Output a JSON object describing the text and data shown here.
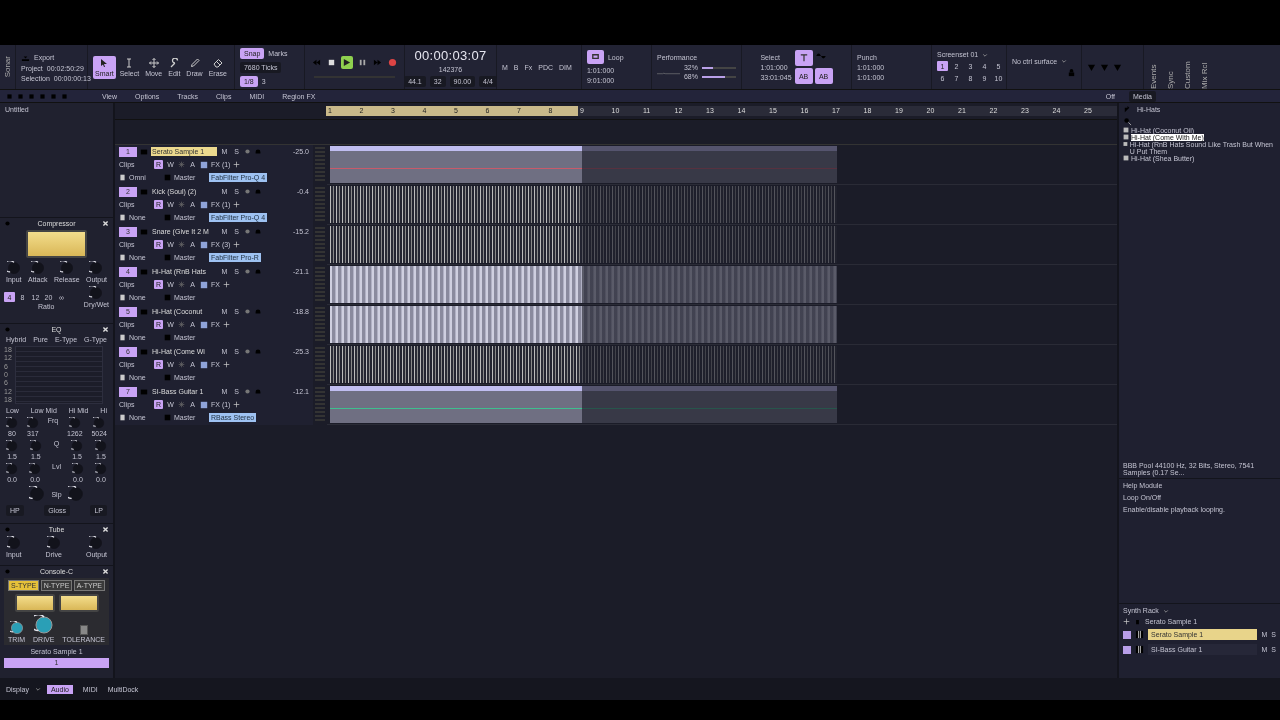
{
  "control_bar": {
    "app_name": "Sonar",
    "export": "Export",
    "project": {
      "label": "Project",
      "value": "00:02:50:29"
    },
    "selection": {
      "label": "Selection",
      "value": "00:00:00:13"
    },
    "tools": [
      {
        "label": "Smart",
        "selected": true
      },
      {
        "label": "Select",
        "selected": false
      },
      {
        "label": "Move",
        "selected": false
      },
      {
        "label": "Edit",
        "selected": false
      },
      {
        "label": "Draw",
        "selected": false
      },
      {
        "label": "Erase",
        "selected": false
      }
    ],
    "snap": {
      "label": "Snap",
      "on": true,
      "marks": "Marks",
      "resolution": "7680 Ticks",
      "value": "1/8",
      "number": "3"
    },
    "transport": {
      "playing": true
    },
    "time": "00:00:03:07",
    "ticks": "142376",
    "sample_rate": "44.1",
    "bit_depth": "32",
    "tempo": "90.00",
    "meter": "4/4",
    "mix_buttons": [
      "M",
      "B",
      "Fx",
      "PDC",
      "DIM"
    ],
    "loop": {
      "label": "Loop",
      "on": true,
      "start": "1:01:000",
      "end": "9:01:000"
    },
    "performance": {
      "label": "Performance",
      "cpu": {
        "reading": "32%",
        "level": 0.32
      },
      "disk": {
        "reading": "68%",
        "level": 0.68
      }
    },
    "select": {
      "label": "Select",
      "start": "1:01:000",
      "end": "33:01:045",
      "ab_labels": [
        "AB",
        "AB"
      ]
    },
    "punch": {
      "label": "Punch",
      "start": "1:01:000",
      "end": "1:01:000"
    },
    "screenset": {
      "label": "Screenset 01",
      "slots": [
        {
          "label": "1",
          "selected": true
        },
        {
          "label": "2",
          "selected": false
        },
        {
          "label": "3",
          "selected": false
        },
        {
          "label": "4",
          "selected": false
        },
        {
          "label": "5",
          "selected": false
        },
        {
          "label": "6",
          "selected": false
        },
        {
          "label": "7",
          "selected": false
        },
        {
          "label": "8",
          "selected": false
        },
        {
          "label": "9",
          "selected": false
        },
        {
          "label": "10",
          "selected": false
        }
      ]
    },
    "control_surface": "No ctrl surface",
    "side_tabs": [
      "Events",
      "Sync",
      "Custom",
      "Mix Rcl"
    ]
  },
  "toolbar": {
    "menus": [
      "View",
      "Options",
      "Tracks",
      "Clips",
      "MIDI",
      "Region FX"
    ],
    "region_fx": "Off",
    "browser_tab": "Media"
  },
  "inspector": {
    "title": "Untitled",
    "compressor": {
      "title": "Compressor",
      "knobs": [
        "Input",
        "Attack",
        "Release",
        "Output"
      ],
      "ratios": [
        {
          "label": "4",
          "selected": true
        },
        {
          "label": "8",
          "selected": false
        },
        {
          "label": "12",
          "selected": false
        },
        {
          "label": "20",
          "selected": false
        },
        {
          "label": "∞",
          "selected": false
        }
      ],
      "ratio_label": "Ratio",
      "mix_label": "Dry/Wet"
    },
    "eq": {
      "title": "EQ",
      "types": [
        "Hybrid",
        "Pure",
        "E-Type",
        "G-Type"
      ],
      "scale": [
        "18",
        "12",
        "6",
        "0",
        "6",
        "12",
        "18"
      ],
      "bands": [
        "Low",
        "Low Mid",
        "Hi Mid",
        "Hi"
      ],
      "freq": [
        "80",
        "317",
        "1262",
        "5024"
      ],
      "freq_label": "Frq",
      "q": [
        "1.5",
        "1.5",
        "1.5",
        "1.5"
      ],
      "q_label": "Q",
      "gain": [
        "0.0",
        "0.0",
        "0.0",
        "0.0"
      ],
      "gain_label": "Lvl",
      "slope_label": "Slp",
      "filters": [
        "HP",
        "Gloss",
        "LP"
      ]
    },
    "tube": {
      "title": "Tube",
      "knobs": [
        "Input",
        "Drive",
        "Output"
      ]
    },
    "console": {
      "title": "Console-C",
      "types": [
        {
          "label": "S-TYPE",
          "selected": true
        },
        {
          "label": "N-TYPE",
          "selected": false
        },
        {
          "label": "A-TYPE",
          "selected": false
        }
      ],
      "knobs": [
        "TRIM",
        "DRIVE"
      ],
      "switch": "TOLERANCE",
      "switch_on": false,
      "track_name": "Serato Sample 1",
      "track_number": "1"
    }
  },
  "tracks": [
    {
      "number": "1",
      "name": "Serato Sample 1",
      "selected": true,
      "volume": "-25.0",
      "buttons": [
        {
          "label": "M",
          "on": false
        },
        {
          "label": "S",
          "on": false
        },
        {
          "label": "R",
          "on": true
        },
        {
          "label": "W",
          "on": false
        },
        {
          "label": "A",
          "on": false
        }
      ],
      "view": "Clips",
      "input": "Omni",
      "output": "Master",
      "fx": "FX (1)",
      "plugin": "FabFilter Pro-Q 4",
      "clip": {
        "kind": "header",
        "color": "#c85a6a"
      }
    },
    {
      "number": "2",
      "name": "Kick (Soul) (2)",
      "selected": false,
      "volume": "-0.4",
      "buttons": [
        {
          "label": "M",
          "on": false
        },
        {
          "label": "S",
          "on": false
        },
        {
          "label": "R",
          "on": true
        },
        {
          "label": "W",
          "on": false
        },
        {
          "label": "A",
          "on": false
        }
      ],
      "view": "Clips",
      "input": "None",
      "output": "Master",
      "fx": "FX (1)",
      "plugin": "FabFilter Pro-Q 4",
      "clip": {
        "kind": "dense"
      }
    },
    {
      "number": "3",
      "name": "Snare (Give It 2 M",
      "selected": false,
      "volume": "-15.2",
      "buttons": [
        {
          "label": "M",
          "on": false
        },
        {
          "label": "S",
          "on": false
        },
        {
          "label": "R",
          "on": true
        },
        {
          "label": "W",
          "on": false
        },
        {
          "label": "A",
          "on": false
        }
      ],
      "view": "Clips",
      "input": "None",
      "output": "Master",
      "fx": "FX (3)",
      "plugin": "FabFilter Pro-R",
      "clip": {
        "kind": "dense"
      }
    },
    {
      "number": "4",
      "name": "Hi-Hat (RnB Hats",
      "selected": false,
      "volume": "-21.1",
      "buttons": [
        {
          "label": "M",
          "on": false
        },
        {
          "label": "S",
          "on": false
        },
        {
          "label": "R",
          "on": true
        },
        {
          "label": "W",
          "on": false
        },
        {
          "label": "A",
          "on": false
        }
      ],
      "view": "Clips",
      "input": "None",
      "output": "Master",
      "fx": "FX",
      "clip": {
        "kind": "light"
      }
    },
    {
      "number": "5",
      "name": "Hi-Hat (Coconut",
      "selected": false,
      "volume": "-18.8",
      "buttons": [
        {
          "label": "M",
          "on": false
        },
        {
          "label": "S",
          "on": false
        },
        {
          "label": "R",
          "on": true
        },
        {
          "label": "W",
          "on": false
        },
        {
          "label": "A",
          "on": false
        }
      ],
      "view": "Clips",
      "input": "None",
      "output": "Master",
      "fx": "FX",
      "clip": {
        "kind": "light"
      }
    },
    {
      "number": "6",
      "name": "Hi-Hat (Come Wi",
      "selected": false,
      "volume": "-25.3",
      "buttons": [
        {
          "label": "M",
          "on": false
        },
        {
          "label": "S",
          "on": false
        },
        {
          "label": "R",
          "on": true
        },
        {
          "label": "W",
          "on": false
        },
        {
          "label": "A",
          "on": false
        }
      ],
      "view": "Clips",
      "input": "None",
      "output": "Master",
      "fx": "FX",
      "clip": {
        "kind": "dense"
      }
    },
    {
      "number": "7",
      "name": "SI-Bass Guitar 1",
      "selected": false,
      "volume": "-12.1",
      "buttons": [
        {
          "label": "M",
          "on": false
        },
        {
          "label": "S",
          "on": false
        },
        {
          "label": "R",
          "on": true
        },
        {
          "label": "W",
          "on": false
        },
        {
          "label": "A",
          "on": false
        }
      ],
      "view": "Clips",
      "input": "None",
      "output": "Master",
      "fx": "FX (1)",
      "plugin": "RBass Stereo",
      "clip": {
        "kind": "header",
        "color": "#3fbf8f"
      }
    }
  ],
  "ruler": [
    "1",
    "2",
    "3",
    "4",
    "5",
    "6",
    "7",
    "8",
    "9",
    "10",
    "11",
    "12",
    "13",
    "14",
    "15",
    "16",
    "17",
    "18",
    "19",
    "20",
    "21",
    "22",
    "23",
    "24",
    "25"
  ],
  "browser": {
    "folder": "Hi-Hats",
    "files": [
      {
        "name": "Hi-Hat (Coconut Oil)",
        "selected": false
      },
      {
        "name": "Hi-Hat (Come With Me)",
        "selected": true
      },
      {
        "name": "Hi-Hat (RnB Hats Sound Like Trash But When U Put Them",
        "selected": false
      },
      {
        "name": "Hi-Hat (Shea Butter)",
        "selected": false
      }
    ],
    "info": "BBB Pool 44100 Hz, 32 Bits, Stereo, 7541 Samples (0.17 Se..."
  },
  "help": {
    "title": "Help Module",
    "heading": "Loop On/Off",
    "text": "Enable/disable playback looping."
  },
  "synth_rack": {
    "title": "Synth Rack",
    "current": "Serato Sample 1",
    "items": [
      {
        "name": "Serato Sample 1",
        "selected": true,
        "buttons": [
          "M",
          "S"
        ]
      },
      {
        "name": "SI-Bass Guitar 1",
        "selected": false,
        "buttons": [
          "M",
          "S"
        ]
      }
    ]
  },
  "status_bar": {
    "display": "Display",
    "modes": [
      {
        "label": "Audio",
        "selected": true
      },
      {
        "label": "MIDI",
        "selected": false
      }
    ],
    "dock": "MultiDock"
  }
}
